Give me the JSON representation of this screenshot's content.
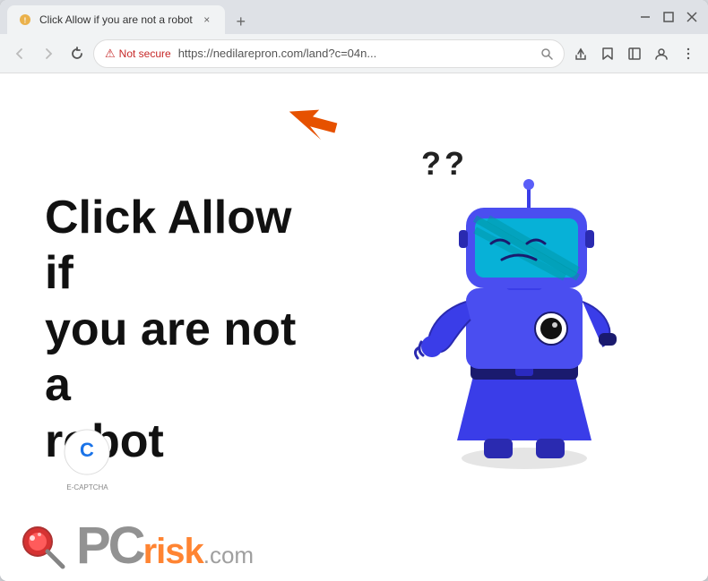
{
  "browser": {
    "title": "Click Allow if you are not a robot",
    "tab_label": "Click Allow if you are not a robot",
    "url": "https://nedilarepron.com/land?c=04n...",
    "url_short": "https://nedilarepron.com/land?c=04n...",
    "security_label": "Not secure",
    "new_tab_symbol": "+",
    "close_symbol": "×",
    "minimize_symbol": "—",
    "maximize_symbol": "□",
    "window_close_symbol": "×"
  },
  "toolbar": {
    "back_label": "←",
    "forward_label": "→",
    "reload_label": "↻",
    "search_icon_label": "⚲",
    "share_icon_label": "⬆",
    "bookmark_icon_label": "☆",
    "sidebar_icon_label": "▤",
    "account_icon_label": "👤",
    "menu_icon_label": "⋮"
  },
  "page": {
    "heading": "Click Allow if you are not a robot",
    "heading_line1": "Click Allow if",
    "heading_line2": "you are not a",
    "heading_line3": "robot",
    "question_marks": "??",
    "captcha_label": "E-CAPTCHA"
  },
  "watermark": {
    "pc_text": "PC",
    "risk_text": "risk",
    "com_text": ".com"
  },
  "colors": {
    "not_secure_red": "#c62828",
    "orange_arrow": "#e65100",
    "robot_blue": "#3a3de8",
    "robot_dark_blue": "#2c2fa0",
    "text_dark": "#111111",
    "orange_brand": "#ff6600"
  }
}
